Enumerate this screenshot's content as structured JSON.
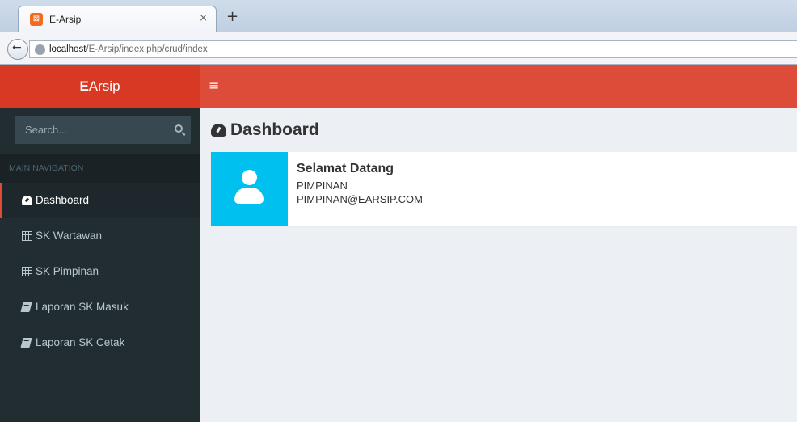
{
  "browser": {
    "tab_title": "E-Arsip",
    "tab_close": "×",
    "new_tab": "+",
    "url_host": "localhost",
    "url_path": "/E-Arsip/index.php/crud/index"
  },
  "app": {
    "logo_bold": "E",
    "logo_rest": "Arsip",
    "menu_toggle": "≡",
    "accent_color": "#dd4b39",
    "logo_color": "#d73925"
  },
  "sidebar": {
    "search_placeholder": "Search...",
    "header": "MAIN NAVIGATION",
    "items": [
      {
        "label": "Dashboard",
        "icon": "dashboard-icon",
        "active": true
      },
      {
        "label": "SK Wartawan",
        "icon": "table-icon",
        "active": false
      },
      {
        "label": "SK Pimpinan",
        "icon": "table-icon",
        "active": false
      },
      {
        "label": "Laporan SK Masuk",
        "icon": "book-icon",
        "active": false
      },
      {
        "label": "Laporan SK Cetak",
        "icon": "book-icon",
        "active": false
      }
    ]
  },
  "main": {
    "title": "Dashboard",
    "info_box": {
      "title": "Selamat Datang",
      "role": "PIMPINAN",
      "email": "PIMPINAN@EARSIP.COM",
      "icon": "user-icon",
      "icon_bg": "#00c0ef"
    }
  }
}
